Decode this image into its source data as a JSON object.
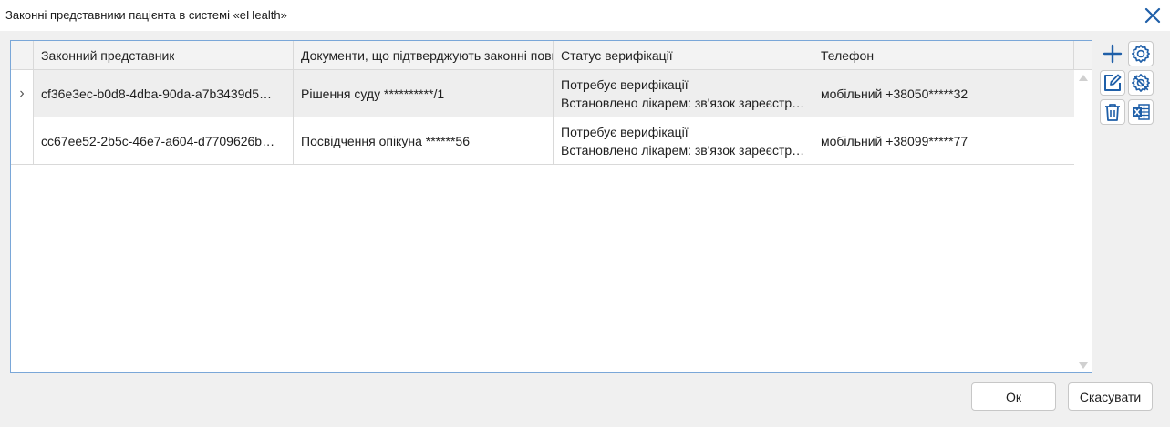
{
  "window": {
    "title": "Законні представники пацієнта в системі «eHealth»"
  },
  "table": {
    "columns": [
      "Законний представник",
      "Документи, що підтверджують законні повноваження",
      "Статус верифікації",
      "Телефон"
    ],
    "rows": [
      {
        "indicator": "›",
        "representative": "cf36e3ec-b0d8-4dba-90da-a7b3439d5…",
        "document": "Рішення суду **********/1",
        "status_line1": "Потребує верифікації",
        "status_line2": "Встановлено лікарем: зв'язок зареєстровано",
        "phone": "мобільний +38050*****32"
      },
      {
        "indicator": "",
        "representative": "cc67ee52-2b5c-46e7-a604-d7709626b…",
        "document": "Посвідчення опікуна ******56",
        "status_line1": "Потребує верифікації",
        "status_line2": "Встановлено лікарем: зв'язок зареєстровано",
        "phone": "мобільний +38099*****77"
      }
    ]
  },
  "toolbar": {
    "icons": [
      "plus-icon",
      "settings-gear-icon",
      "edit-icon",
      "settings-gear-alt-icon",
      "trash-icon",
      "excel-export-icon"
    ]
  },
  "footer": {
    "ok_label": "Ок",
    "cancel_label": "Скасувати"
  },
  "colors": {
    "accent": "#1f5fa8",
    "border_focus": "#7aa7d8",
    "selected_row": "#eeeeee"
  }
}
